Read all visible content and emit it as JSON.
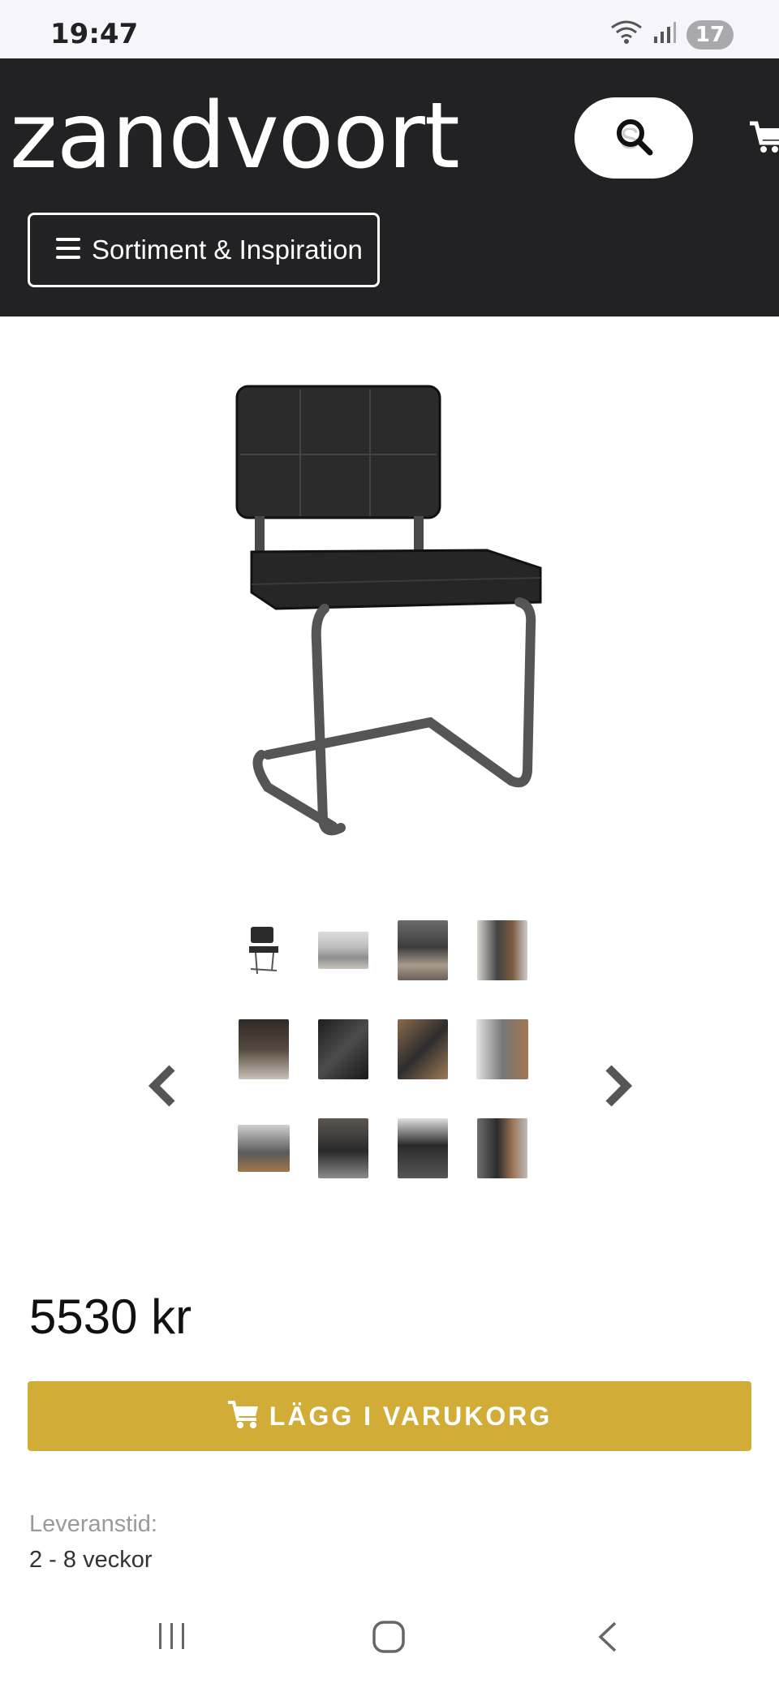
{
  "status_bar": {
    "time": "19:47",
    "notification_count": "17",
    "icons": [
      "wifi-icon",
      "signal-icon"
    ]
  },
  "header": {
    "brand": "zandvoort",
    "search_placeholder": "S",
    "menu_label": "Sortiment & Inspiration",
    "background": "#222124"
  },
  "product": {
    "image_icon": "chair-icon",
    "thumbnail_count": 12,
    "price": "5530 kr",
    "add_to_cart_label": "LÄGG I VARUKORG",
    "cta_color": "#d1ad37",
    "lead_time_label": "Leveranstid:",
    "lead_time_value": "2 - 8 veckor"
  },
  "nav_bar": {
    "items": [
      "recent-apps-icon",
      "home-icon",
      "back-icon"
    ]
  }
}
